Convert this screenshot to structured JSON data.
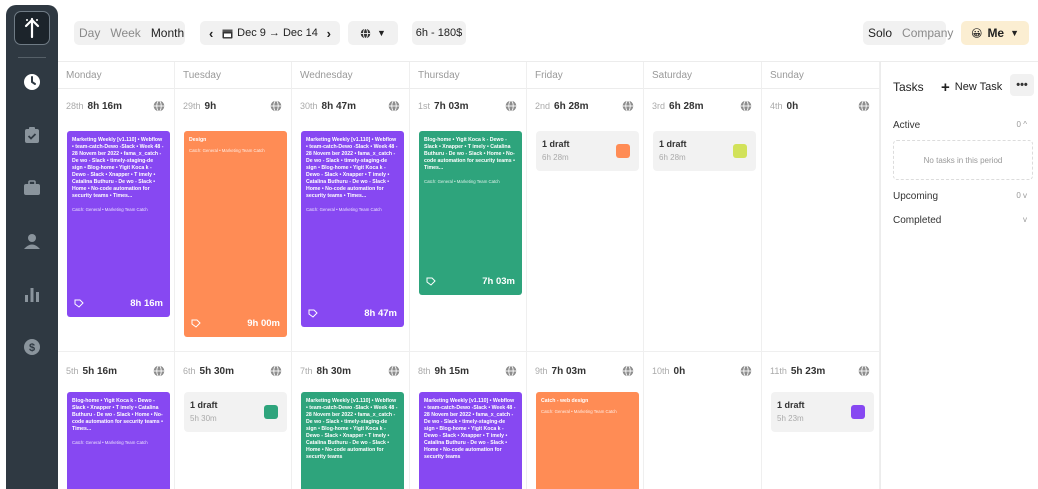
{
  "header": {
    "views": [
      {
        "label": "Day"
      },
      {
        "label": "Week"
      },
      {
        "label": "Month"
      }
    ],
    "active_view": "Month",
    "prev_icon": "chevron-left-icon",
    "next_icon": "chevron-right-icon",
    "date_range": "Dec 9 → Dec 14",
    "calendar_icon": "calendar-icon",
    "filter_icon": "globe-icon",
    "summary": "6h - 180$",
    "scopes": [
      {
        "label": "Solo"
      },
      {
        "label": "Company"
      }
    ],
    "active_scope": "Solo",
    "user_label": "Me",
    "user_emoji": "😀"
  },
  "days": [
    {
      "name": "Monday"
    },
    {
      "name": "Tuesday"
    },
    {
      "name": "Wednesday"
    },
    {
      "name": "Thursday"
    },
    {
      "name": "Friday"
    },
    {
      "name": "Saturday"
    },
    {
      "name": "Sunday"
    }
  ],
  "week1": [
    {
      "date": "28th",
      "total": "8h 16m"
    },
    {
      "date": "29th",
      "total": "9h"
    },
    {
      "date": "30th",
      "total": "8h 47m"
    },
    {
      "date": "1st",
      "total": "7h 03m"
    },
    {
      "date": "2nd",
      "total": "6h 28m"
    },
    {
      "date": "3rd",
      "total": "6h 28m"
    },
    {
      "date": "4th",
      "total": "0h"
    }
  ],
  "week2": [
    {
      "date": "5th",
      "total": "5h 16m"
    },
    {
      "date": "6th",
      "total": "5h 30m"
    },
    {
      "date": "7th",
      "total": "8h 30m"
    },
    {
      "date": "8th",
      "total": "9h 15m"
    },
    {
      "date": "9th",
      "total": "7h 03m"
    },
    {
      "date": "10th",
      "total": "0h"
    },
    {
      "date": "11th",
      "total": "5h 23m"
    }
  ],
  "events": {
    "mon1": {
      "title": "Marketing Weekly [v1.110] • Webflow • team-catch-Dewo -Slack • Week 48 - 28 Novem ber 2022 • fama_x_catch - De wo - Slack • timely-staging-de sign • Blog-home • Yigit Koca k - Dewo - Slack • Xnapper • T imely • Catalina Buthuru - De wo - Slack • Home • No-code automation for security teams • Times...",
      "meta": "Catch: General • Marketing Team Catch",
      "duration": "8h 16m",
      "color": "#8748f2"
    },
    "tue1": {
      "title": "Design",
      "meta": "Catch: General • Marketing Team Catch",
      "duration": "9h 00m",
      "color": "#ff8c55"
    },
    "wed1": {
      "title": "Marketing Weekly [v1.110] • Webflow • team-catch-Dewo -Slack • Week 48 - 28 Novem ber 2022 • fama_x_catch - De wo - Slack • timely-staging-de sign • Blog-home • Yigit Koca k - Dewo - Slack • Xnapper • T imely • Catalina Buthuru - De wo - Slack • Home • No-code automation for security teams • Times...",
      "meta": "Catch: General • Marketing Team Catch",
      "duration": "8h 47m",
      "color": "#8748f2"
    },
    "thu1": {
      "title": "Blog-home • Yigit Koca k - Dewo - Slack • Xnapper • T imely • Catalina Buthuru - De wo - Slack • Home • No-code automation for security teams • Times...",
      "meta": "Catch: General • Marketing Team Catch",
      "duration": "7h 03m",
      "color": "#2ea47c"
    },
    "mon2": {
      "title": "Blog-home • Yigit Koca k - Dewo - Slack • Xnapper • T imely • Catalina Buthuru - De wo - Slack • Home • No-code automation for security teams • Times...",
      "meta": "Catch: General • Marketing Team Catch",
      "color": "#8748f2"
    },
    "wed2": {
      "title": "Marketing Weekly [v1.110] • Webflow • team-catch-Dewo -Slack • Week 48 - 28 Novem ber 2022 • fama_x_catch - De wo - Slack • timely-staging-de sign • Blog-home • Yigit Koca k - Dewo - Slack • Xnapper • T imely • Catalina Buthuru - De wo - Slack • Home • No-code automation for security teams",
      "color": "#2ea47c"
    },
    "thu2": {
      "title": "Marketing Weekly [v1.110] • Webflow • team-catch-Dewo -Slack • Week 48 - 28 Novem ber 2022 • fama_x_catch - De wo - Slack • timely-staging-de sign • Blog-home • Yigit Koca k - Dewo - Slack • Xnapper • T imely • Catalina Buthuru - De wo - Slack • Home • No-code automation for security teams",
      "color": "#8748f2"
    },
    "fri2": {
      "title": "Catch - web design",
      "meta": "Catch: General • Marketing Team Catch",
      "color": "#ff8c55"
    }
  },
  "drafts": {
    "fri1": {
      "label": "1 draft",
      "duration": "6h 28m",
      "color": "#ff8c55"
    },
    "sat1": {
      "label": "1 draft",
      "duration": "6h 28m",
      "color": "#d2e25a"
    },
    "tue2": {
      "label": "1 draft",
      "duration": "5h 30m",
      "color": "#2ea47c"
    },
    "sun2": {
      "label": "1 draft",
      "duration": "5h 23m",
      "color": "#8748f2"
    }
  },
  "tasks": {
    "title": "Tasks",
    "new_label": "New Task",
    "more_label": "•••",
    "active_label": "Active",
    "active_count": "0",
    "empty_text": "No tasks in this period",
    "upcoming_label": "Upcoming",
    "upcoming_count": "0",
    "completed_label": "Completed"
  },
  "rail": {
    "items": [
      {
        "name": "clock-icon"
      },
      {
        "name": "clipboard-check-icon"
      },
      {
        "name": "briefcase-icon"
      },
      {
        "name": "user-icon"
      },
      {
        "name": "bar-chart-icon"
      },
      {
        "name": "dollar-icon"
      }
    ]
  },
  "colors": {
    "purple": "#8748f2",
    "orange": "#ff8c55",
    "green": "#2ea47c",
    "rail": "#2f3942"
  }
}
